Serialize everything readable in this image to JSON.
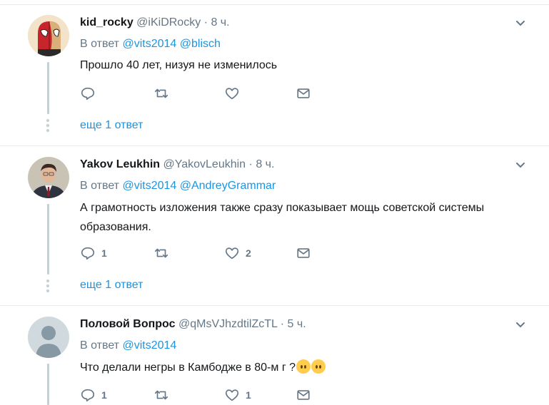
{
  "tweets": [
    {
      "name": "kid_rocky",
      "handle": "@iKiDRocky",
      "dot": "·",
      "time": "8 ч.",
      "reply_prefix": "В ответ",
      "mentions": [
        "@vits2014",
        "@blisch"
      ],
      "text": "Прошло 40 лет, низуя не изменилось",
      "reply_count": "",
      "like_count": "",
      "more_replies": "еще 1 ответ",
      "avatar": "spiderman-deadpool-avatar"
    },
    {
      "name": "Yakov Leukhin",
      "handle": "@YakovLeukhin",
      "dot": "·",
      "time": "8 ч.",
      "reply_prefix": "В ответ",
      "mentions": [
        "@vits2014",
        "@AndreyGrammar"
      ],
      "text": "А грамотность изложения также сразу показывает мощь советской системы образования.",
      "reply_count": "1",
      "like_count": "2",
      "more_replies": "еще 1 ответ",
      "avatar": "photo-avatar"
    },
    {
      "name": "Половой Вопрос",
      "handle": "@qMsVJhzdtilZcTL",
      "dot": "·",
      "time": "5 ч.",
      "reply_prefix": "В ответ",
      "mentions": [
        "@vits2014"
      ],
      "text": "Что делали негры в Камбодже в 80-м г ?",
      "reply_count": "1",
      "like_count": "1",
      "avatar": "default-avatar"
    }
  ],
  "colors": {
    "link": "#1b95e0",
    "muted": "#657786",
    "divider": "#e6ecf0",
    "thread": "#c4cfd6"
  }
}
